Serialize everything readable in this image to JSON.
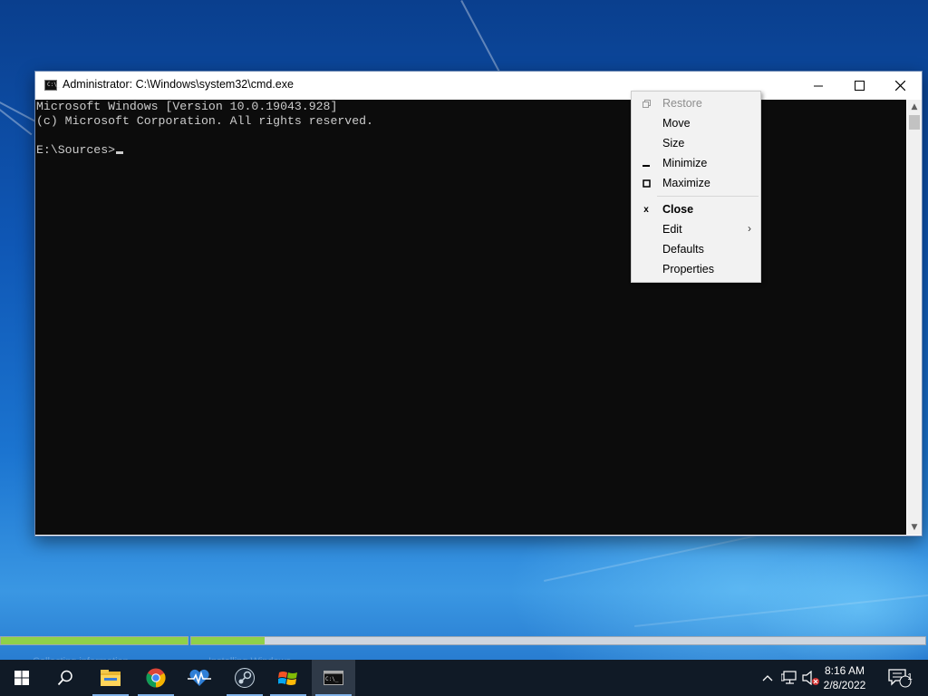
{
  "window": {
    "title": "Administrator: C:\\Windows\\system32\\cmd.exe",
    "icon_text": "C:\\_",
    "buttons": {
      "minimize": "—",
      "maximize": "☐",
      "close": "✕"
    }
  },
  "console": {
    "lines": [
      "Microsoft Windows [Version 10.0.19043.928]",
      "(c) Microsoft Corporation. All rights reserved.",
      "",
      "E:\\Sources>"
    ]
  },
  "context_menu": {
    "items": [
      {
        "label": "Restore",
        "icon": "restore-icon",
        "disabled": true
      },
      {
        "label": "Move",
        "icon": "",
        "disabled": false
      },
      {
        "label": "Size",
        "icon": "",
        "disabled": false
      },
      {
        "label": "Minimize",
        "icon": "minimize-icon",
        "disabled": false
      },
      {
        "label": "Maximize",
        "icon": "maximize-icon",
        "disabled": false
      },
      {
        "label": "Close",
        "icon": "close-icon",
        "disabled": false,
        "bold": true
      },
      {
        "label": "Edit",
        "icon": "",
        "disabled": false,
        "submenu": true
      },
      {
        "label": "Defaults",
        "icon": "",
        "disabled": false
      },
      {
        "label": "Properties",
        "icon": "",
        "disabled": false
      }
    ]
  },
  "progress": {
    "bars": [
      {
        "fill_fraction": 1.0
      },
      {
        "fill_fraction": 0.1
      }
    ],
    "labels": [
      "Collecting information",
      "Installing Windows"
    ]
  },
  "taskbar": {
    "apps": [
      "start-icon",
      "search-icon",
      "file-explorer-icon",
      "chrome-icon",
      "health-icon",
      "steam-icon",
      "windows-setup-icon",
      "cmd-icon"
    ],
    "clock_time": "8:16 AM",
    "clock_date": "2/8/2022",
    "notification_count": "1"
  },
  "colors": {
    "console_bg": "#0c0c0c",
    "console_fg": "#cccccc",
    "progress_fill": "#8fd14a",
    "taskbar_bg": "#101a26"
  }
}
